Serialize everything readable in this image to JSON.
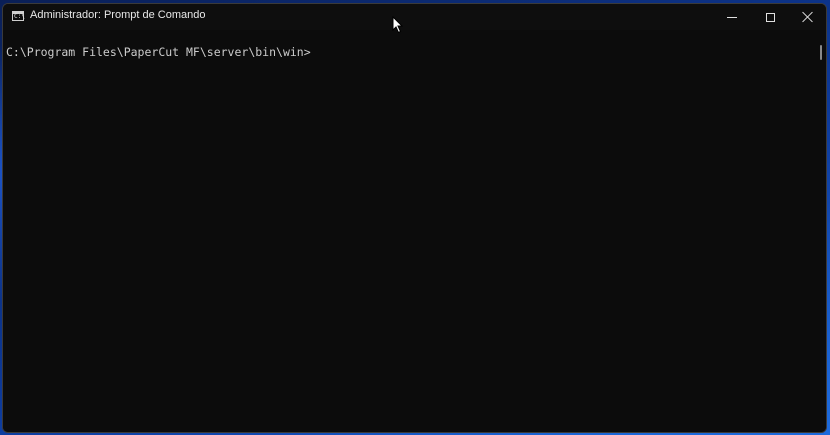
{
  "window": {
    "title": "Administrador: Prompt de Comando",
    "icon": "cmd-icon",
    "icon_glyph": "C:\\"
  },
  "console": {
    "prompt": "C:\\Program Files\\PaperCut MF\\server\\bin\\win>"
  },
  "caption_buttons": {
    "minimize": "minimize-icon",
    "maximize": "maximize-icon",
    "close": "close-icon"
  },
  "colors": {
    "console_bg": "#0c0c0c",
    "console_text": "#cccccc",
    "titlebar_bg": "#0e0e0e"
  }
}
